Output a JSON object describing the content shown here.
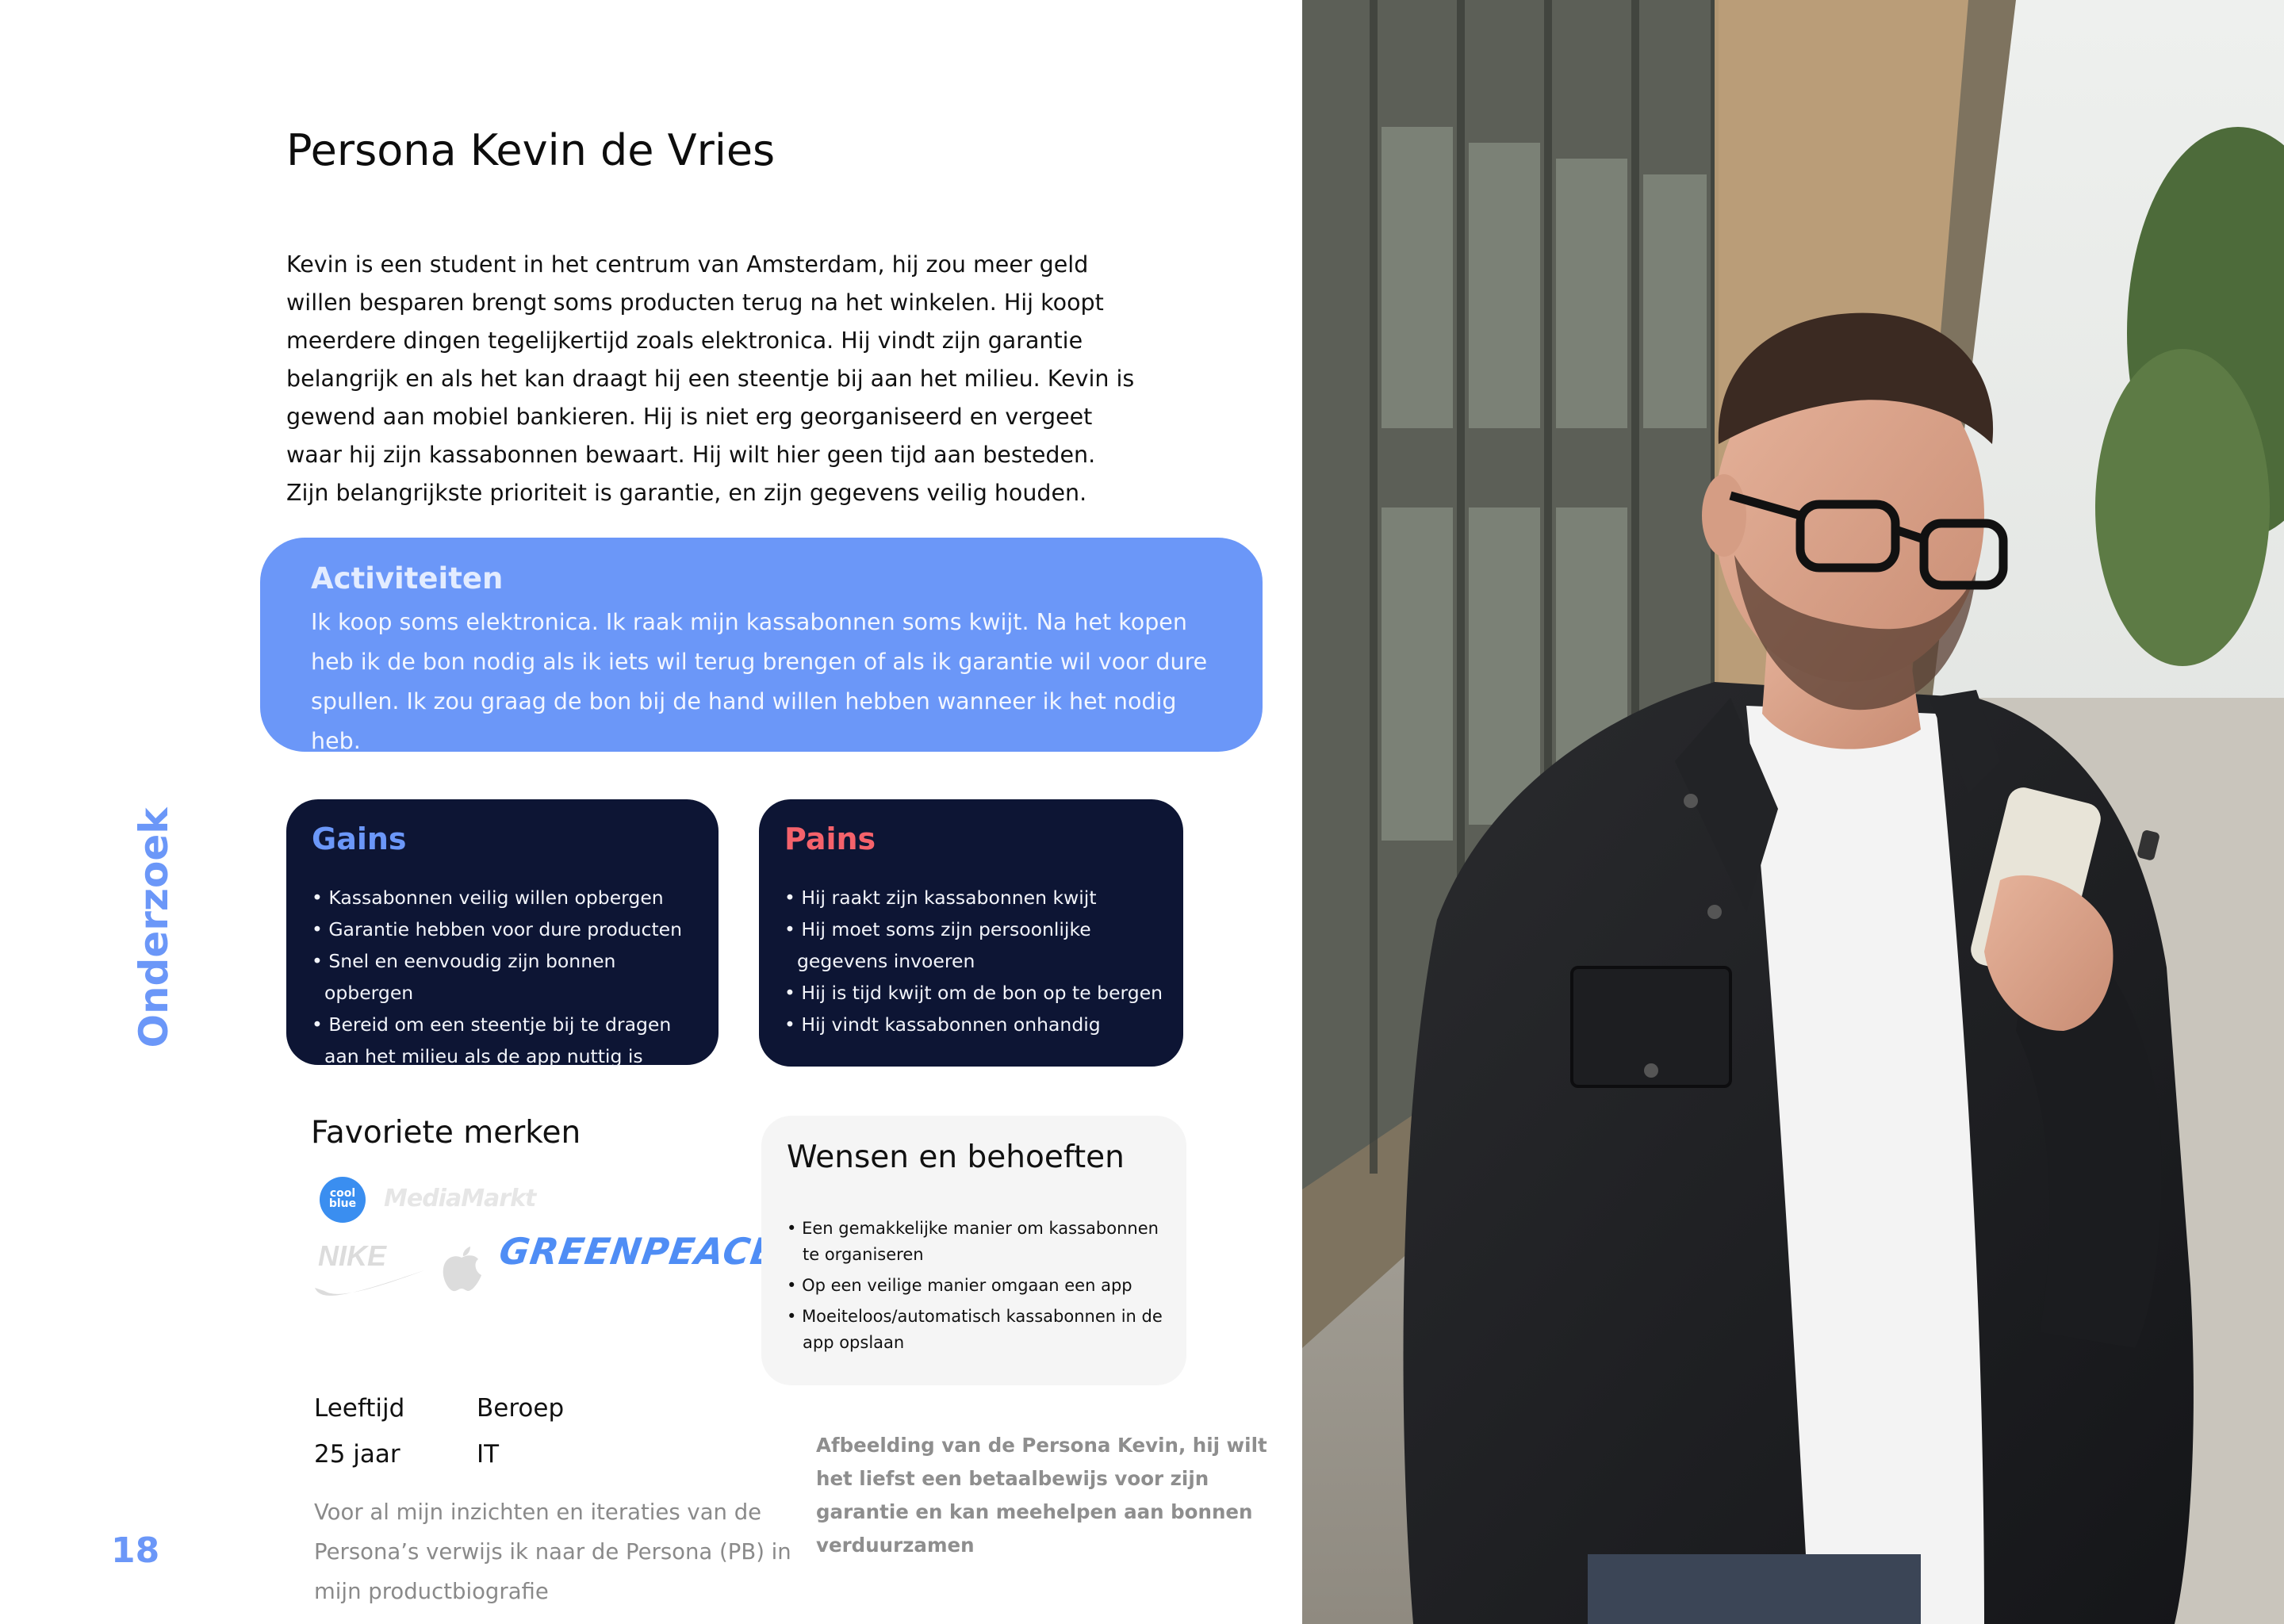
{
  "section": "Onderzoek",
  "page_number": "18",
  "title": "Persona Kevin de Vries",
  "intro": "Kevin is een student in het centrum van Amsterdam, hij zou meer geld willen besparen brengt soms producten terug na het winkelen. Hij koopt meerdere dingen tegelijkertijd zoals elektronica. Hij vindt zijn garantie belangrijk en als het kan draagt hij een steentje bij aan het milieu. Kevin is gewend aan mobiel bankieren. Hij is niet erg georganiseerd en vergeet waar hij zijn kassabonnen bewaart. Hij wilt hier geen tijd aan besteden. Zijn belangrijkste prioriteit is garantie, en zijn gegevens veilig houden.",
  "activities": {
    "heading": "Activiteiten",
    "text": "Ik koop soms elektronica. Ik raak mijn kassabonnen soms kwijt. Na het kopen heb ik de bon nodig als ik iets wil terug brengen of als ik garantie wil voor dure spullen. Ik zou graag de bon bij de hand willen hebben wanneer ik het nodig heb."
  },
  "gains": {
    "heading": "Gains",
    "items": [
      "Kassabonnen veilig willen opbergen",
      "Garantie hebben voor dure producten",
      "Snel en eenvoudig zijn bonnen opbergen",
      "Bereid om een steentje bij te dragen aan het milieu als de app nuttig is"
    ]
  },
  "pains": {
    "heading": "Pains",
    "items": [
      "Hij raakt zijn kassabonnen kwijt",
      "Hij moet soms zijn persoonlijke gegevens invoeren",
      "Hij is tijd kwijt om de bon op te bergen",
      "Hij vindt kassabonnen onhandig"
    ]
  },
  "brands": {
    "heading": "Favoriete merken",
    "logos": [
      {
        "name": "coolblue",
        "text": "cool blue"
      },
      {
        "name": "mediamarkt",
        "text": "MediaMarkt"
      },
      {
        "name": "nike",
        "text": "NIKE"
      },
      {
        "name": "apple"
      },
      {
        "name": "greenpeace",
        "text": "GREENPEACE"
      }
    ]
  },
  "wishes": {
    "heading": "Wensen en behoeften",
    "items": [
      "Een gemakkelijke manier om kassabonnen te organiseren",
      "Op een veilige manier omgaan een app",
      "Moeiteloos/automatisch kassabonnen in de app opslaan"
    ]
  },
  "profile": {
    "age_label": "Leeftijd",
    "age_value": "25 jaar",
    "job_label": "Beroep",
    "job_value": "IT"
  },
  "note": "Voor al mijn inzichten en iteraties van de Persona’s verwijs ik naar de Persona (PB) in mijn productbiografie",
  "caption": "Afbeelding van de Persona Kevin, hij wilt het liefst een betaalbewijs voor zijn garantie en kan  meehelpen aan bonnen verduurzamen",
  "colors": {
    "accent_blue": "#6b97f8",
    "pains_red": "#f5626b",
    "dark_navy": "#0d1534"
  }
}
